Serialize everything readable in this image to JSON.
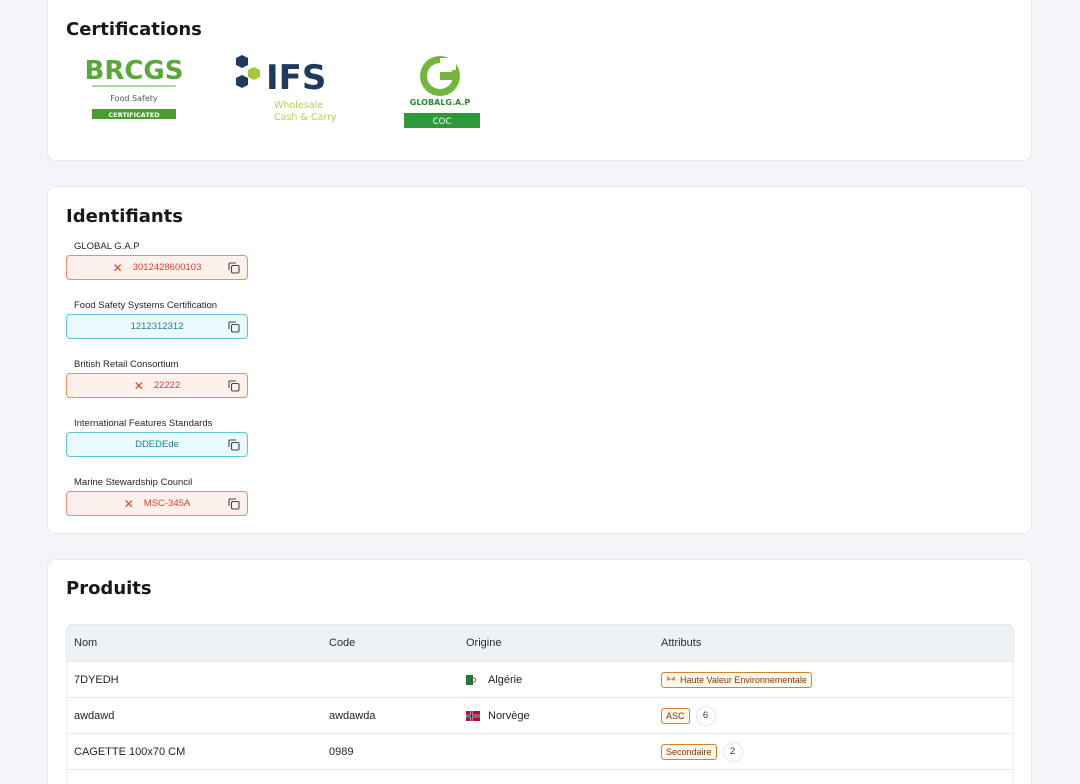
{
  "certifications": {
    "title": "Certifications",
    "brcgs": {
      "name": "BRCGS",
      "sub": "Food Safety",
      "badge": "CERTIFICATED"
    },
    "ifs": {
      "name": "IFS",
      "sub1": "Wholesale",
      "sub2": "Cash & Carry"
    },
    "globalgap": {
      "name": "GLOBALG.A.P",
      "badge": "COC"
    }
  },
  "identifiants": {
    "title": "Identifiants",
    "items": [
      {
        "label": "GLOBAL G.A.P",
        "value": "3012428600103",
        "status": "error"
      },
      {
        "label": "Food Safety Systems Certification",
        "value": "1212312312",
        "status": "ok"
      },
      {
        "label": "British Retail Consortium",
        "value": "22222",
        "status": "error"
      },
      {
        "label": "International Features Standards",
        "value": "DDEDEde",
        "status": "ok"
      },
      {
        "label": "Marine Stewardship Council",
        "value": "MSC-345A",
        "status": "error"
      }
    ]
  },
  "produits": {
    "title": "Produits",
    "columns": [
      "Nom",
      "Code",
      "Origine",
      "Attributs"
    ],
    "rows": [
      {
        "nom": "7DYEDH",
        "code": "",
        "origine": "Algérie",
        "flag": "algeria",
        "attribut": "Haute Valeur Environnementale",
        "count": ""
      },
      {
        "nom": "awdawd",
        "code": "awdawda",
        "origine": "Norvège",
        "flag": "norway",
        "attribut": "ASC",
        "count": "6"
      },
      {
        "nom": "CAGETTE 100x70 CM",
        "code": "0989",
        "origine": "",
        "flag": "",
        "attribut": "Secondaire",
        "count": "2"
      }
    ]
  }
}
